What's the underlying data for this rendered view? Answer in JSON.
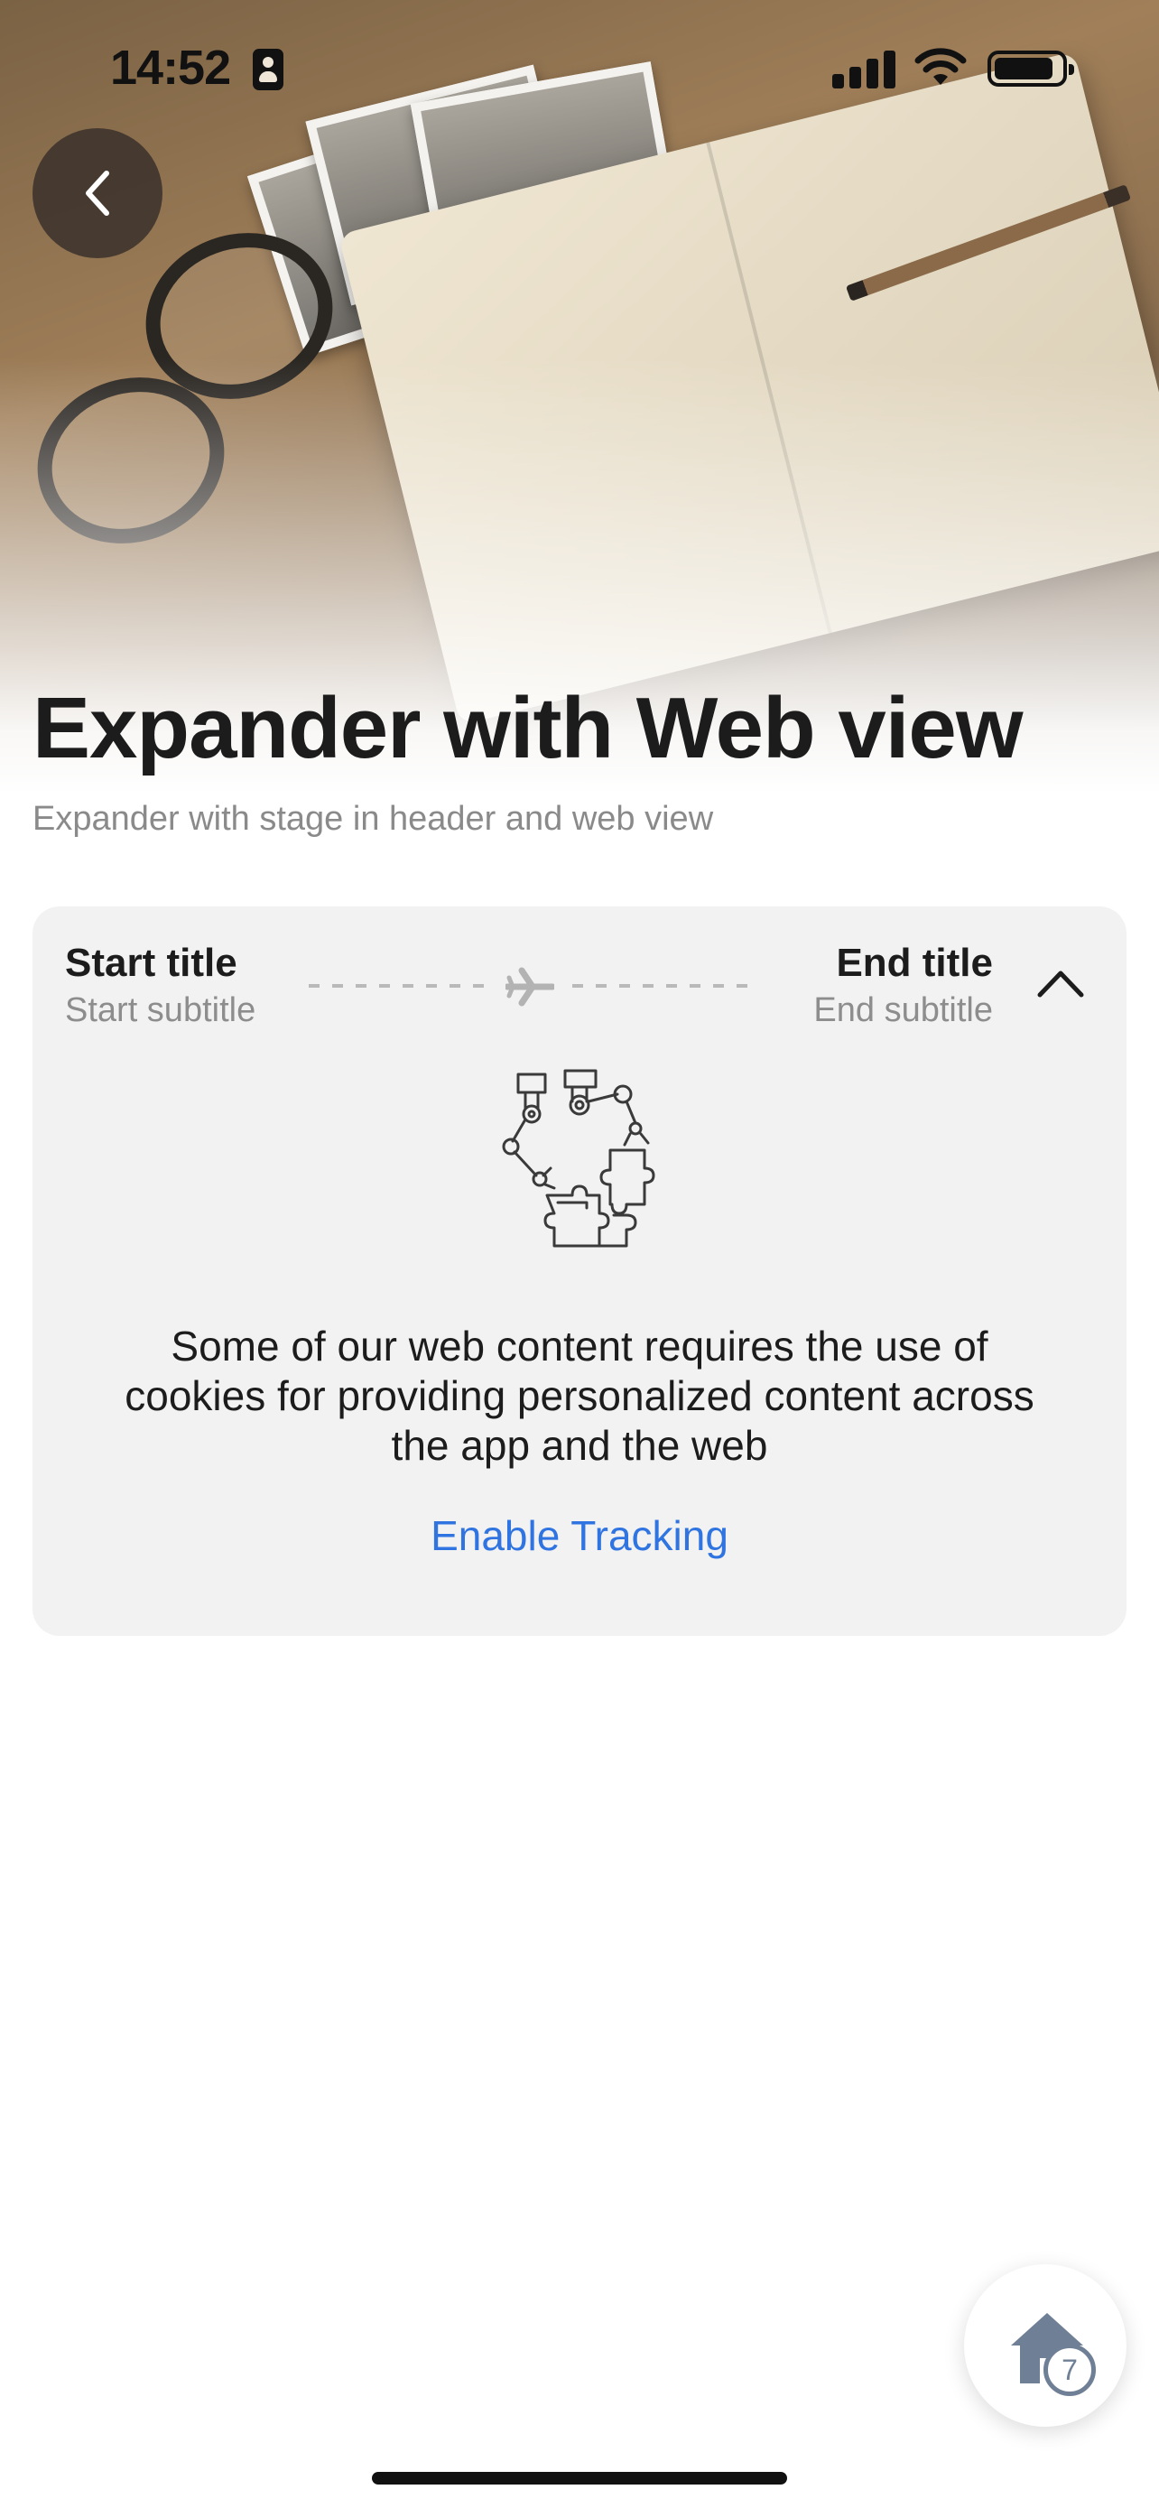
{
  "status_bar": {
    "time": "14:52"
  },
  "header": {
    "title": "Expander with Web view",
    "subtitle": "Expander with stage in header and web view",
    "back_icon": "chevron-left-icon"
  },
  "expander": {
    "start_title": "Start title",
    "start_subtitle": "Start subtitle",
    "end_title": "End title",
    "end_subtitle": "End subtitle",
    "stage_icon": "airplane-icon",
    "toggle_icon": "chevron-up-icon",
    "expanded": true,
    "illustration": "robot-arms-puzzle-illustration",
    "message": "Some of our web content requires the use of cookies for providing personalized content across the app and the web",
    "action_label": "Enable Tracking",
    "action_color": "#2f74e0"
  },
  "home_button": {
    "icon": "home-icon",
    "badge": "7"
  }
}
